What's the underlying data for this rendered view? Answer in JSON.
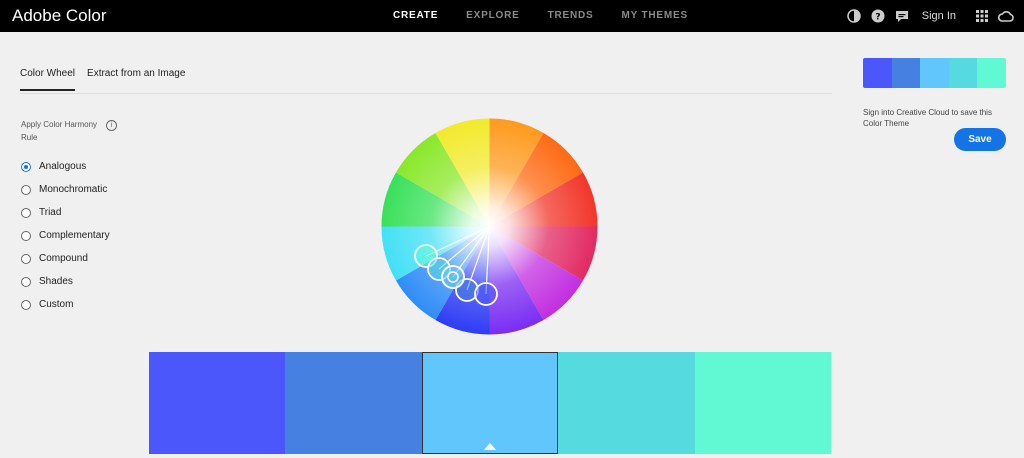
{
  "app": {
    "title": "Adobe Color"
  },
  "nav": {
    "items": [
      {
        "label": "CREATE",
        "active": true
      },
      {
        "label": "EXPLORE",
        "active": false
      },
      {
        "label": "TRENDS",
        "active": false
      },
      {
        "label": "MY THEMES",
        "active": false
      }
    ]
  },
  "header_right": {
    "sign_in": "Sign In",
    "icons": [
      "color-blind-safe-icon",
      "help-icon",
      "feedback-icon",
      "apps-grid-icon",
      "creative-cloud-icon"
    ]
  },
  "tabs": [
    {
      "label": "Color Wheel",
      "active": true
    },
    {
      "label": "Extract from an Image",
      "active": false
    }
  ],
  "harmony": {
    "label": "Apply Color Harmony Rule",
    "selected": "Analogous",
    "rules": [
      "Analogous",
      "Monochromatic",
      "Triad",
      "Complementary",
      "Compound",
      "Shades",
      "Custom"
    ]
  },
  "theme": {
    "colors": [
      "#4b57fa",
      "#4680e0",
      "#60c6fc",
      "#55dae0",
      "#60f9d4"
    ],
    "selected_index": 2
  },
  "sidebar": {
    "message": "Sign into Creative Cloud to save this Color Theme",
    "save_label": "Save"
  },
  "colors": {
    "accent": "#1473e6",
    "topbar": "#000000",
    "background": "#f0f0f0"
  }
}
